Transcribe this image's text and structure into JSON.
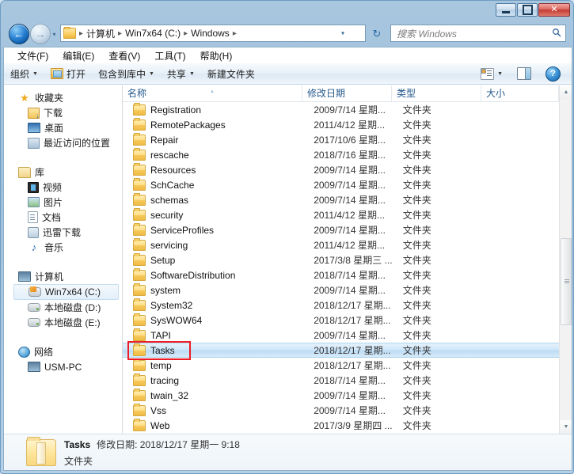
{
  "window": {
    "controls": {
      "minimize": "最小化",
      "maximize": "最大化",
      "close": "✕"
    }
  },
  "nav": {
    "back_label": "后退",
    "back_glyph": "←",
    "forward_label": "前进",
    "forward_glyph": "→",
    "history_glyph": "▾",
    "breadcrumbs": [
      "计算机",
      "Win7x64 (C:)",
      "Windows"
    ],
    "separator": "▸",
    "dropdown_glyph": "▾",
    "refresh_glyph": "↻",
    "search_placeholder": "搜索 Windows",
    "search_value": "",
    "search_icon": "🔍"
  },
  "menubar": {
    "items": [
      {
        "label": "文件(F)"
      },
      {
        "label": "编辑(E)"
      },
      {
        "label": "查看(V)"
      },
      {
        "label": "工具(T)"
      },
      {
        "label": "帮助(H)"
      }
    ]
  },
  "toolbar": {
    "organize": "组织",
    "open": "打开",
    "include_in_library": "包含到库中",
    "share": "共享",
    "new_folder": "新建文件夹",
    "caret": "▼",
    "help_glyph": "?"
  },
  "sidebar": {
    "groups": [
      {
        "header": {
          "label": "收藏夹",
          "icon": "star-icon"
        },
        "items": [
          {
            "label": "下载",
            "icon": "downloads-icon"
          },
          {
            "label": "桌面",
            "icon": "desktop-icon"
          },
          {
            "label": "最近访问的位置",
            "icon": "recent-places-icon"
          }
        ]
      },
      {
        "header": {
          "label": "库",
          "icon": "library-icon"
        },
        "items": [
          {
            "label": "视频",
            "icon": "video-icon"
          },
          {
            "label": "图片",
            "icon": "pictures-icon"
          },
          {
            "label": "文档",
            "icon": "documents-icon"
          },
          {
            "label": "迅雷下载",
            "icon": "thunder-download-icon"
          },
          {
            "label": "音乐",
            "icon": "music-icon"
          }
        ]
      },
      {
        "header": {
          "label": "计算机",
          "icon": "computer-icon"
        },
        "items": [
          {
            "label": "Win7x64 (C:)",
            "icon": "windows-drive-icon",
            "selected": true
          },
          {
            "label": "本地磁盘 (D:)",
            "icon": "hdd-icon"
          },
          {
            "label": "本地磁盘 (E:)",
            "icon": "hdd-icon"
          }
        ]
      },
      {
        "header": {
          "label": "网络",
          "icon": "network-icon"
        },
        "items": [
          {
            "label": "USM-PC",
            "icon": "computer-icon"
          }
        ]
      }
    ]
  },
  "filelist": {
    "columns": [
      {
        "label": "名称",
        "sorted": true
      },
      {
        "label": "修改日期",
        "sorted": false
      },
      {
        "label": "类型",
        "sorted": false
      },
      {
        "label": "大小",
        "sorted": false
      }
    ],
    "rows": [
      {
        "name": "Registration",
        "date": "2009/7/14 星期...",
        "type": "文件夹",
        "size": ""
      },
      {
        "name": "RemotePackages",
        "date": "2011/4/12 星期...",
        "type": "文件夹",
        "size": ""
      },
      {
        "name": "Repair",
        "date": "2017/10/6 星期...",
        "type": "文件夹",
        "size": ""
      },
      {
        "name": "rescache",
        "date": "2018/7/16 星期...",
        "type": "文件夹",
        "size": ""
      },
      {
        "name": "Resources",
        "date": "2009/7/14 星期...",
        "type": "文件夹",
        "size": ""
      },
      {
        "name": "SchCache",
        "date": "2009/7/14 星期...",
        "type": "文件夹",
        "size": ""
      },
      {
        "name": "schemas",
        "date": "2009/7/14 星期...",
        "type": "文件夹",
        "size": ""
      },
      {
        "name": "security",
        "date": "2011/4/12 星期...",
        "type": "文件夹",
        "size": ""
      },
      {
        "name": "ServiceProfiles",
        "date": "2009/7/14 星期...",
        "type": "文件夹",
        "size": ""
      },
      {
        "name": "servicing",
        "date": "2011/4/12 星期...",
        "type": "文件夹",
        "size": ""
      },
      {
        "name": "Setup",
        "date": "2017/3/8 星期三 ...",
        "type": "文件夹",
        "size": ""
      },
      {
        "name": "SoftwareDistribution",
        "date": "2018/7/14 星期...",
        "type": "文件夹",
        "size": ""
      },
      {
        "name": "system",
        "date": "2009/7/14 星期...",
        "type": "文件夹",
        "size": ""
      },
      {
        "name": "System32",
        "date": "2018/12/17 星期...",
        "type": "文件夹",
        "size": ""
      },
      {
        "name": "SysWOW64",
        "date": "2018/12/17 星期...",
        "type": "文件夹",
        "size": ""
      },
      {
        "name": "TAPI",
        "date": "2009/7/14 星期...",
        "type": "文件夹",
        "size": ""
      },
      {
        "name": "Tasks",
        "date": "2018/12/17 星期...",
        "type": "文件夹",
        "size": "",
        "selected": true,
        "annotated": true
      },
      {
        "name": "temp",
        "date": "2018/12/17 星期...",
        "type": "文件夹",
        "size": ""
      },
      {
        "name": "tracing",
        "date": "2018/7/14 星期...",
        "type": "文件夹",
        "size": ""
      },
      {
        "name": "twain_32",
        "date": "2009/7/14 星期...",
        "type": "文件夹",
        "size": ""
      },
      {
        "name": "Vss",
        "date": "2009/7/14 星期...",
        "type": "文件夹",
        "size": ""
      },
      {
        "name": "Web",
        "date": "2017/3/9 星期四 ...",
        "type": "文件夹",
        "size": ""
      }
    ],
    "scrollbar": {
      "up_glyph": "▲",
      "down_glyph": "▼"
    }
  },
  "details": {
    "name": "Tasks",
    "modified": "修改日期: 2018/12/17 星期一 9:18",
    "type": "文件夹"
  },
  "colors": {
    "accent": "#2f86d6",
    "annotation": "#ee1c25",
    "selection": "#cfe6f8",
    "header_text": "#25598c"
  }
}
